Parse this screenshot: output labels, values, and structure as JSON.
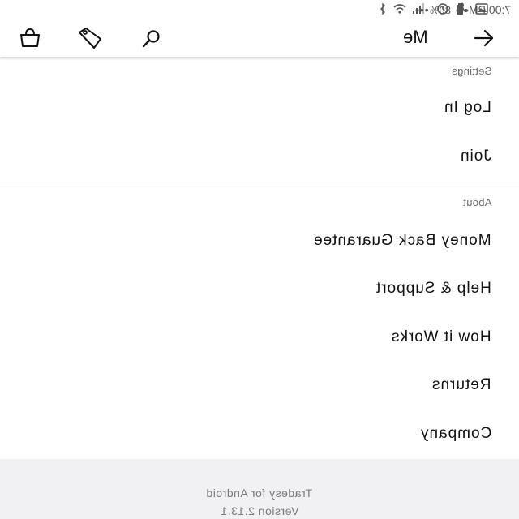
{
  "status_bar": {
    "time": "7:00 PM",
    "battery": "80%",
    "icons": [
      "dots-icon",
      "alarm-icon",
      "fan-icon",
      "gallery-icon",
      "battery-icon",
      "signal-icon",
      "wifi-icon",
      "bluetooth-icon"
    ]
  },
  "header": {
    "title": "Me",
    "icons": [
      "back-arrow-icon",
      "search-icon",
      "tag-icon",
      "shopping-bag-icon"
    ]
  },
  "sections": {
    "settings": {
      "title": "Settings",
      "items": [
        {
          "label": "Log In"
        },
        {
          "label": "Join"
        }
      ]
    },
    "about": {
      "title": "About",
      "items": [
        {
          "label": "Money Back Guarantee"
        },
        {
          "label": "Help & Support"
        },
        {
          "label": "How it Works"
        },
        {
          "label": "Returns"
        },
        {
          "label": "Company"
        }
      ]
    }
  },
  "footer": {
    "app_name": "Tradesy for Android",
    "version": "Version 2.13.1"
  }
}
